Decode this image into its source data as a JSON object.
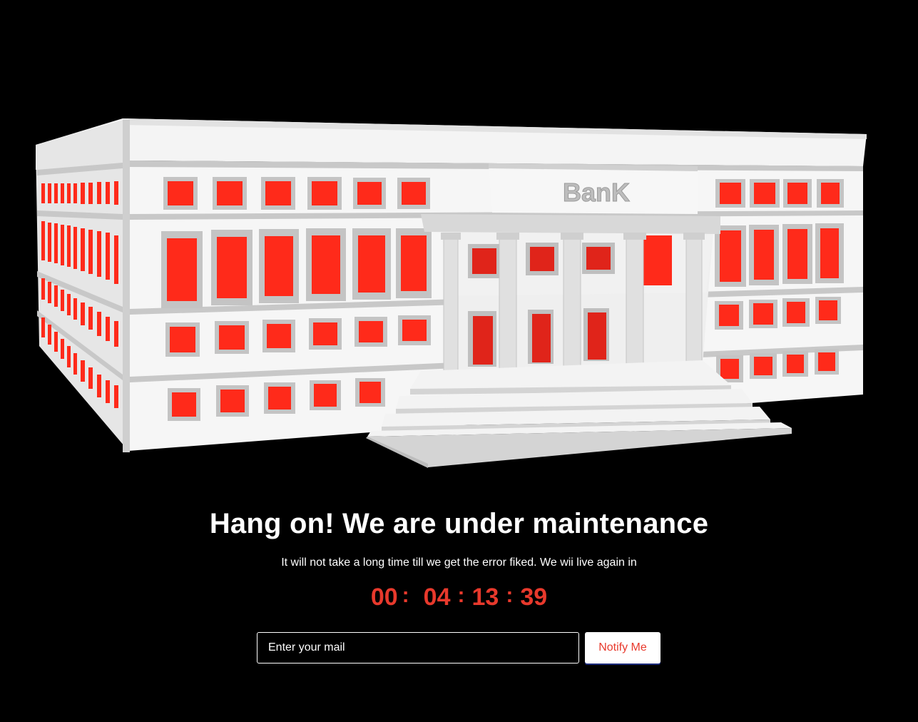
{
  "illustration": {
    "building_sign": "BanK",
    "colors": {
      "wall": "#f2f2f2",
      "window": "#ff2a1a",
      "frame": "#bdbdbd"
    }
  },
  "headline": "Hang on! We are under maintenance",
  "subtext": "It will not take a long time till we get the error fiked. We wii live again in",
  "countdown": {
    "days": "00",
    "hours": "04",
    "minutes": "13",
    "seconds": "39",
    "separator": ":"
  },
  "form": {
    "email_placeholder": "Enter your mail",
    "email_value": "",
    "notify_label": "Notify Me"
  },
  "colors": {
    "background": "#000000",
    "accent": "#e8392c",
    "text": "#ffffff"
  }
}
